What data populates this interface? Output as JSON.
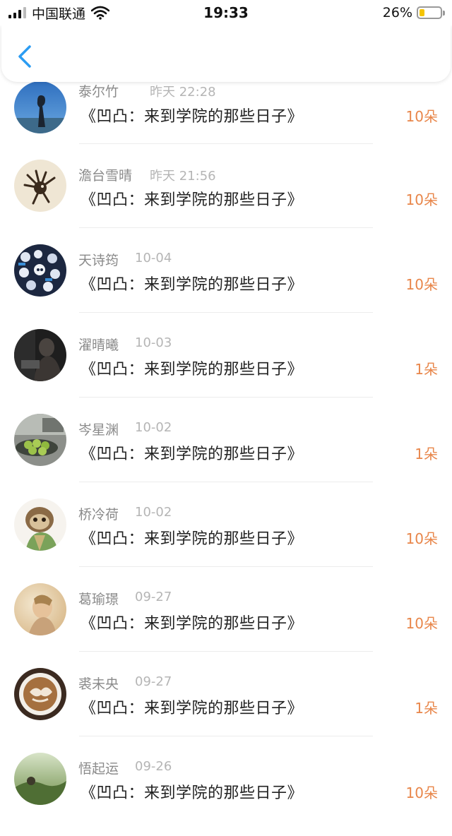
{
  "status_bar": {
    "carrier": "中国联通",
    "time": "19:33",
    "battery_percent": "26%",
    "battery_level": 0.26,
    "battery_color": "#f5c400"
  },
  "nav": {
    "back_icon": "chevron-left-icon",
    "accent": "#2b9cf2"
  },
  "colors": {
    "gift_count": "#e8864a"
  },
  "items": [
    {
      "name": "泰尔竹",
      "time": "昨天 22:28",
      "book": "《凹凸：来到学院的那些日子》",
      "count": "10朵"
    },
    {
      "name": "澹台雪晴",
      "time": "昨天 21:56",
      "book": "《凹凸：来到学院的那些日子》",
      "count": "10朵"
    },
    {
      "name": "天诗筠",
      "time": "10-04",
      "book": "《凹凸：来到学院的那些日子》",
      "count": "10朵"
    },
    {
      "name": "濯晴曦",
      "time": "10-03",
      "book": "《凹凸：来到学院的那些日子》",
      "count": "1朵"
    },
    {
      "name": "岑星渊",
      "time": "10-02",
      "book": "《凹凸：来到学院的那些日子》",
      "count": "1朵"
    },
    {
      "name": "桥冷荷",
      "time": "10-02",
      "book": "《凹凸：来到学院的那些日子》",
      "count": "10朵"
    },
    {
      "name": "葛瑜璟",
      "time": "09-27",
      "book": "《凹凸：来到学院的那些日子》",
      "count": "10朵"
    },
    {
      "name": "裘未央",
      "time": "09-27",
      "book": "《凹凸：来到学院的那些日子》",
      "count": "1朵"
    },
    {
      "name": "悟起运",
      "time": "09-26",
      "book": "《凹凸：来到学院的那些日子》",
      "count": "10朵"
    }
  ]
}
